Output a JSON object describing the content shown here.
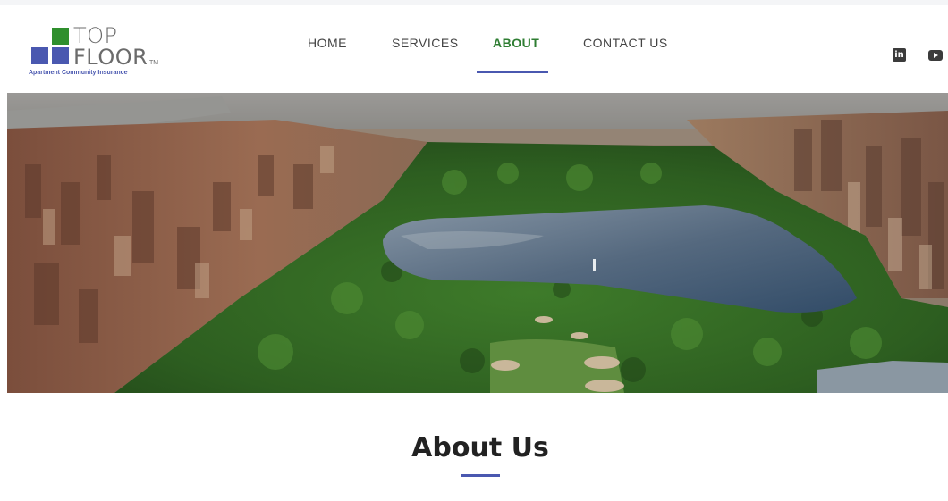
{
  "brand": {
    "name_line1": "TOP",
    "name_line2": "FLOOR",
    "trademark": "TM",
    "tagline": "Apartment Community Insurance",
    "colors": {
      "green": "#2f8f2d",
      "blue": "#4a58b0"
    }
  },
  "nav": {
    "items": [
      {
        "label": "HOME",
        "active": false
      },
      {
        "label": "SERVICES",
        "active": false
      },
      {
        "label": "ABOUT",
        "active": true
      },
      {
        "label": "CONTACT US",
        "active": false
      }
    ],
    "active_color": "#2e7d32"
  },
  "social": [
    {
      "icon": "linkedin-icon",
      "glyph": "in"
    },
    {
      "icon": "youtube-icon"
    }
  ],
  "hero": {
    "image": "aerial-city-park-lake"
  },
  "about": {
    "title": "About Us"
  }
}
